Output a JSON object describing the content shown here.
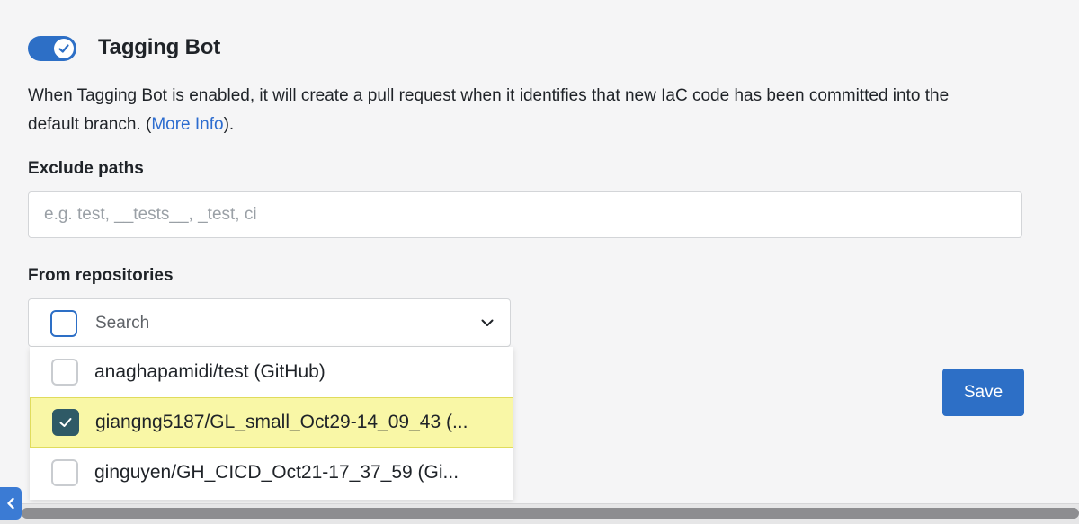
{
  "header": {
    "title": "Tagging Bot",
    "toggle_on": true
  },
  "description": {
    "text": "When Tagging Bot is enabled, it will create a pull request when it identifies that new IaC code has been committed into the default branch. (",
    "link": "More Info",
    "suffix": ")."
  },
  "exclude_paths": {
    "label": "Exclude paths",
    "placeholder": "e.g. test, __tests__, _test, ci",
    "value": ""
  },
  "repositories": {
    "label": "From repositories",
    "search_placeholder": "Search",
    "options": [
      {
        "label": "anaghapamidi/test (GitHub)",
        "checked": false
      },
      {
        "label": "giangng5187/GL_small_Oct29-14_09_43 (...",
        "checked": true
      },
      {
        "label": "ginguyen/GH_CICD_Oct21-17_37_59 (Gi...",
        "checked": false
      }
    ]
  },
  "save_label": "Save",
  "colors": {
    "accent": "#2d6fc6",
    "checked": "#2f5a66",
    "highlight": "#f9f7a6"
  }
}
